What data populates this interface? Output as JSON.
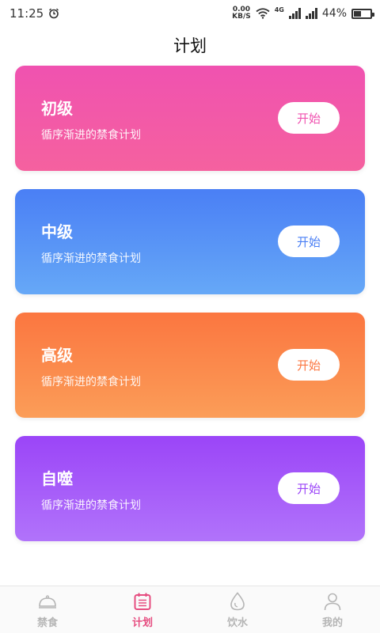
{
  "status_bar": {
    "time": "11:25",
    "net_speed_value": "0.00",
    "net_speed_unit": "KB/S",
    "network_type": "4G",
    "battery_percent": "44%",
    "battery_level": 0.44
  },
  "header": {
    "title": "计划"
  },
  "plans": [
    {
      "title": "初级",
      "description": "循序渐进的禁食计划",
      "button_label": "开始",
      "color_start": "#f052b0",
      "color_end": "#f5619f"
    },
    {
      "title": "中级",
      "description": "循序渐进的禁食计划",
      "button_label": "开始",
      "color_start": "#4a7ff5",
      "color_end": "#66a8f7"
    },
    {
      "title": "高级",
      "description": "循序渐进的禁食计划",
      "button_label": "开始",
      "color_start": "#fb7640",
      "color_end": "#fb9d58"
    },
    {
      "title": "自噬",
      "description": "循序渐进的禁食计划",
      "button_label": "开始",
      "color_start": "#9b45f8",
      "color_end": "#b173fa"
    }
  ],
  "tab_bar": {
    "tabs": [
      {
        "label": "禁食",
        "icon": "dish-cover-icon",
        "active": false
      },
      {
        "label": "计划",
        "icon": "calendar-icon",
        "active": true
      },
      {
        "label": "饮水",
        "icon": "water-drop-icon",
        "active": false
      },
      {
        "label": "我的",
        "icon": "user-icon",
        "active": false
      }
    ],
    "active_color": "#e64d80",
    "inactive_color": "#b5b5b5"
  }
}
